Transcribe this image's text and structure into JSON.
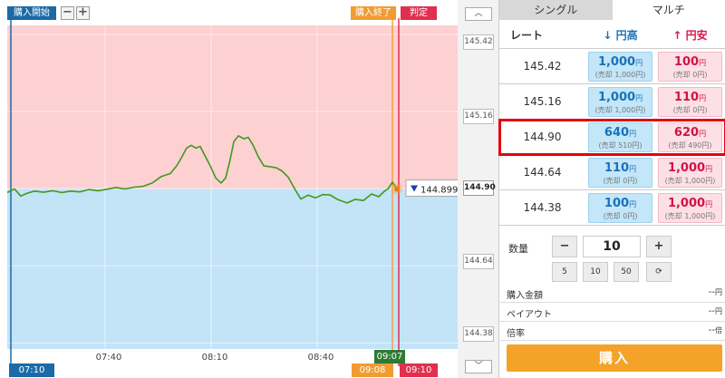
{
  "chart": {
    "tag_start": "購入開始",
    "tag_end": "購入終了",
    "tag_judge": "判定",
    "zoom_minus": "−",
    "zoom_plus": "+",
    "x_ticks": [
      "07:40",
      "08:10",
      "08:40"
    ],
    "time_start": "07:10",
    "time_current": "09:07",
    "time_end": "09:08",
    "time_judge": "09:10",
    "current_price": "144.899",
    "colors": {
      "upper_zone": "#fdd0d2",
      "lower_zone": "#c3e3f7",
      "line": "#3f9a1c",
      "start_line": "#1a6aa8",
      "end_line": "#f0a040",
      "judge_line": "#e03050",
      "tag_start_bg": "#1a6aa8",
      "tag_end_bg": "#f09c32",
      "tag_judge_bg": "#e0304e",
      "tag_current_bg": "#2f7a34"
    }
  },
  "chart_data": {
    "type": "line",
    "series": [
      {
        "values": [
          [
            0,
            144.887
          ],
          [
            8,
            144.899
          ],
          [
            15,
            144.875
          ],
          [
            22,
            144.885
          ],
          [
            30,
            144.892
          ],
          [
            40,
            144.888
          ],
          [
            50,
            144.893
          ],
          [
            60,
            144.887
          ],
          [
            70,
            144.892
          ],
          [
            80,
            144.889
          ],
          [
            90,
            144.897
          ],
          [
            100,
            144.893
          ],
          [
            110,
            144.898
          ],
          [
            120,
            144.904
          ],
          [
            130,
            144.899
          ],
          [
            140,
            144.905
          ],
          [
            150,
            144.908
          ],
          [
            160,
            144.919
          ],
          [
            170,
            144.941
          ],
          [
            180,
            144.951
          ],
          [
            187,
            144.977
          ],
          [
            192,
            145.003
          ],
          [
            198,
            145.037
          ],
          [
            203,
            145.046
          ],
          [
            208,
            145.037
          ],
          [
            213,
            145.042
          ],
          [
            218,
            145.012
          ],
          [
            224,
            144.977
          ],
          [
            230,
            144.936
          ],
          [
            236,
            144.919
          ],
          [
            241,
            144.936
          ],
          [
            246,
            144.998
          ],
          [
            250,
            145.058
          ],
          [
            255,
            145.078
          ],
          [
            261,
            145.068
          ],
          [
            266,
            145.073
          ],
          [
            271,
            145.048
          ],
          [
            277,
            145.008
          ],
          [
            283,
            144.977
          ],
          [
            290,
            144.974
          ],
          [
            297,
            144.97
          ],
          [
            303,
            144.96
          ],
          [
            310,
            144.939
          ],
          [
            318,
            144.895
          ],
          [
            324,
            144.865
          ],
          [
            332,
            144.878
          ],
          [
            340,
            144.869
          ],
          [
            348,
            144.88
          ],
          [
            356,
            144.879
          ],
          [
            365,
            144.863
          ],
          [
            375,
            144.852
          ],
          [
            384,
            144.864
          ],
          [
            393,
            144.86
          ],
          [
            402,
            144.882
          ],
          [
            410,
            144.873
          ],
          [
            416,
            144.891
          ],
          [
            420,
            144.899
          ],
          [
            425,
            144.922
          ],
          [
            430,
            144.899
          ]
        ]
      }
    ],
    "x_ticks": [
      "07:40",
      "08:10",
      "08:40"
    ],
    "y_ticks": [
      145.42,
      145.16,
      144.9,
      144.64,
      144.38
    ],
    "ylim": [
      144.36,
      145.45
    ],
    "grid": true
  },
  "axis": {
    "up_btn": "︿",
    "down_btn": "﹀",
    "labels": [
      "145.42",
      "145.16",
      "144.90",
      "144.64",
      "144.38"
    ]
  },
  "panel": {
    "tab_single": "シングル",
    "tab_multi": "マルチ",
    "header_rate": "レート",
    "header_high": "円高",
    "header_low": "円安",
    "yen": "円",
    "rows": [
      {
        "rate": "145.42",
        "high_amt": "1,000",
        "high_sell": "(売却 1,000円)",
        "low_amt": "100",
        "low_sell": "(売却 0円)"
      },
      {
        "rate": "145.16",
        "high_amt": "1,000",
        "high_sell": "(売却 1,000円)",
        "low_amt": "110",
        "low_sell": "(売却 0円)"
      },
      {
        "rate": "144.90",
        "high_amt": "640",
        "high_sell": "(売却 510円)",
        "low_amt": "620",
        "low_sell": "(売却 490円)"
      },
      {
        "rate": "144.64",
        "high_amt": "110",
        "high_sell": "(売却 0円)",
        "low_amt": "1,000",
        "low_sell": "(売却 1,000円)"
      },
      {
        "rate": "144.38",
        "high_amt": "100",
        "high_sell": "(売却 0円)",
        "low_amt": "1,000",
        "low_sell": "(売却 1,000円)"
      }
    ],
    "qty_label": "数量",
    "qty_minus": "−",
    "qty_value": "10",
    "qty_plus": "+",
    "presets": [
      "5",
      "10",
      "50"
    ],
    "reset_icon": "⟳",
    "purchase_amount_label": "購入金額",
    "purchase_amount_value": "--",
    "payout_label": "ペイアウト",
    "payout_value": "--",
    "multiplier_label": "倍率",
    "multiplier_value": "--",
    "multiplier_unit": "倍",
    "buy_label": "購入"
  }
}
